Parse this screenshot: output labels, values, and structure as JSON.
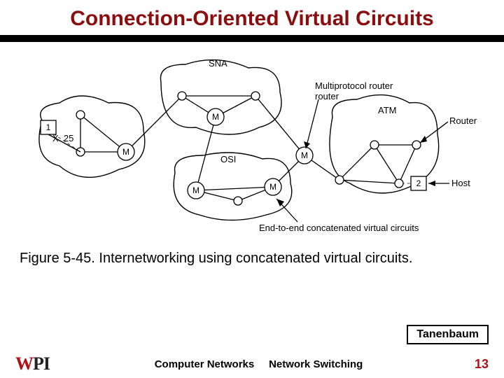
{
  "title": "Connection-Oriented Virtual Circuits",
  "caption": "Figure 5-45. Internetworking using concatenated virtual circuits.",
  "source": "Tanenbaum",
  "footer": {
    "course": "Computer Networks",
    "topic": "Network Switching"
  },
  "page_number": "13",
  "logo": {
    "w": "W",
    "p": "P",
    "i": "I"
  },
  "diagram": {
    "clouds": {
      "x25": "X. 25",
      "sna": "SNA",
      "osi": "OSI",
      "atm": "ATM"
    },
    "external_labels": {
      "multiprotocol_router": "Multiprotocol router",
      "router": "Router",
      "host": "Host",
      "end_to_end": "End-to-end concatenated virtual circuits"
    },
    "node_letter": "M",
    "host1": "1",
    "host2": "2"
  }
}
